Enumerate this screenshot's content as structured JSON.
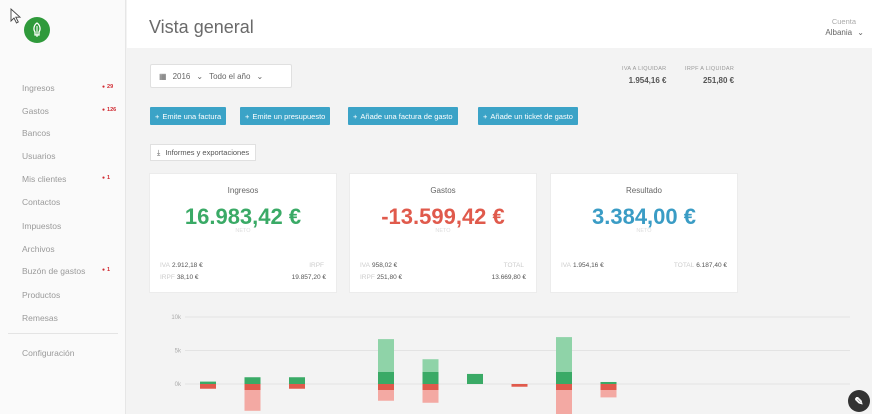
{
  "sidebar": {
    "items": [
      {
        "label": "Ingresos",
        "badge": "29"
      },
      {
        "label": "Gastos",
        "badge": "126"
      },
      {
        "label": "Bancos",
        "badge": ""
      },
      {
        "label": "Usuarios",
        "badge": ""
      },
      {
        "label": "Mis clientes",
        "badge": "1"
      },
      {
        "label": "Contactos",
        "badge": ""
      },
      {
        "label": "Impuestos",
        "badge": ""
      },
      {
        "label": "Archivos",
        "badge": ""
      },
      {
        "label": "Buzón de gastos",
        "badge": "1"
      },
      {
        "label": "Productos",
        "badge": ""
      },
      {
        "label": "Remesas",
        "badge": ""
      }
    ],
    "settings_label": "Configuración"
  },
  "header": {
    "title": "Vista general",
    "account_label": "Cuenta",
    "account_value": "Albania"
  },
  "period": {
    "year": "2016",
    "range": "Todo el año"
  },
  "taxes": {
    "iva_label": "IVA A LIQUIDAR",
    "iva_value": "1.954,16 €",
    "irpf_label": "IRPF A LIQUIDAR",
    "irpf_value": "251,80 €"
  },
  "actions": {
    "emit_invoice": "Emite una factura",
    "emit_quote": "Emite un presupuesto",
    "add_expense_invoice": "Añade una factura de gasto",
    "add_expense_ticket": "Añade un ticket de gasto",
    "reports": "Informes y exportaciones"
  },
  "cards": {
    "income": {
      "title": "Ingresos",
      "value": "16.983,42 €",
      "sub": "NETO",
      "r1k": "IVA",
      "r1v": "2.912,18 €",
      "r1rk": "IRPF",
      "r2k": "IRPF",
      "r2v": "38,10 €",
      "r2rv": "19.857,20 €"
    },
    "expenses": {
      "title": "Gastos",
      "value": "-13.599,42 €",
      "sub": "NETO",
      "r1k": "IVA",
      "r1v": "958,02 €",
      "r1rk": "TOTAL",
      "r2k": "IRPF",
      "r2v": "251,80 €",
      "r2rv": "13.669,80 €"
    },
    "result": {
      "title": "Resultado",
      "value": "3.384,00 €",
      "sub": "NETO",
      "r1k": "IVA",
      "r1v": "1.954,16 €",
      "r1rk": "TOTAL",
      "r1rv": "6.187,40 €"
    }
  },
  "colors": {
    "income": "#3aaa66",
    "expense": "#e05a4c",
    "result": "#3a9cc5",
    "button": "#3ba3c7",
    "logo": "#2f9a3b"
  },
  "chart_data": {
    "type": "bar",
    "yticks": [
      "10k",
      "5k",
      "0k"
    ],
    "ylim": [
      -5000,
      10000
    ],
    "series": [
      {
        "values": [
          350,
          1000,
          1000,
          0,
          6700,
          3700,
          1500,
          0,
          7000,
          300
        ]
      },
      {
        "values": [
          -700,
          -4000,
          -700,
          0,
          -2500,
          -2800,
          0,
          -400,
          -5000,
          -2000
        ]
      }
    ]
  }
}
